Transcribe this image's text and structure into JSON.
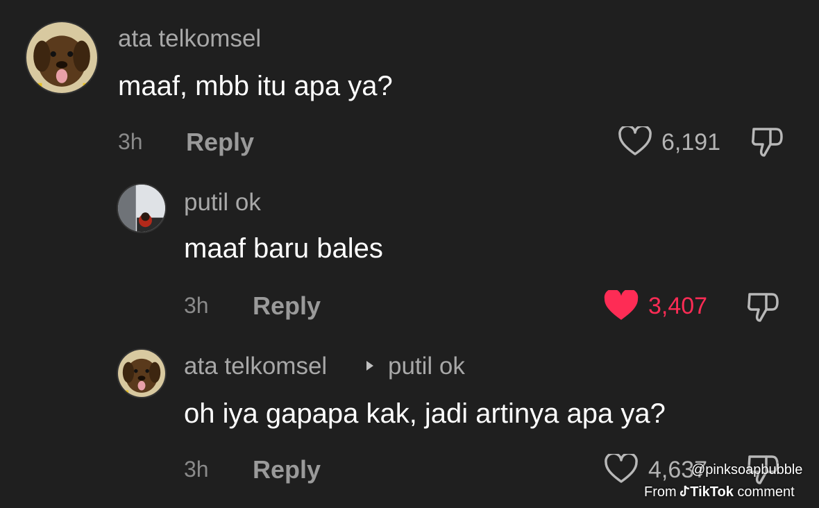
{
  "comments": [
    {
      "username": "ata telkomsel",
      "text": "maaf, mbb itu apa ya?",
      "time": "3h",
      "reply_label": "Reply",
      "like_count": "6,191",
      "liked": false
    },
    {
      "username": "putil ok",
      "text": "maaf baru bales",
      "time": "3h",
      "reply_label": "Reply",
      "like_count": "3,407",
      "liked": true
    },
    {
      "username": "ata telkomsel",
      "reply_to": "putil ok",
      "text": "oh iya gapapa kak, jadi artinya apa ya?",
      "time": "3h",
      "reply_label": "Reply",
      "like_count": "4,637",
      "liked": false
    }
  ],
  "watermark": {
    "handle": "@pinksoapbubble",
    "from": "From",
    "brand": "TikTok",
    "suffix": "comment"
  },
  "colors": {
    "background": "#1f1f1f",
    "liked": "#fe2c55",
    "username": "#a8a8a8",
    "text": "#ffffff"
  },
  "icons": {
    "like": "heart-outline-icon",
    "liked": "heart-filled-icon",
    "dislike": "thumbs-down-icon",
    "reply_arrow": "caret-right-icon",
    "brand": "tiktok-logo-icon"
  }
}
